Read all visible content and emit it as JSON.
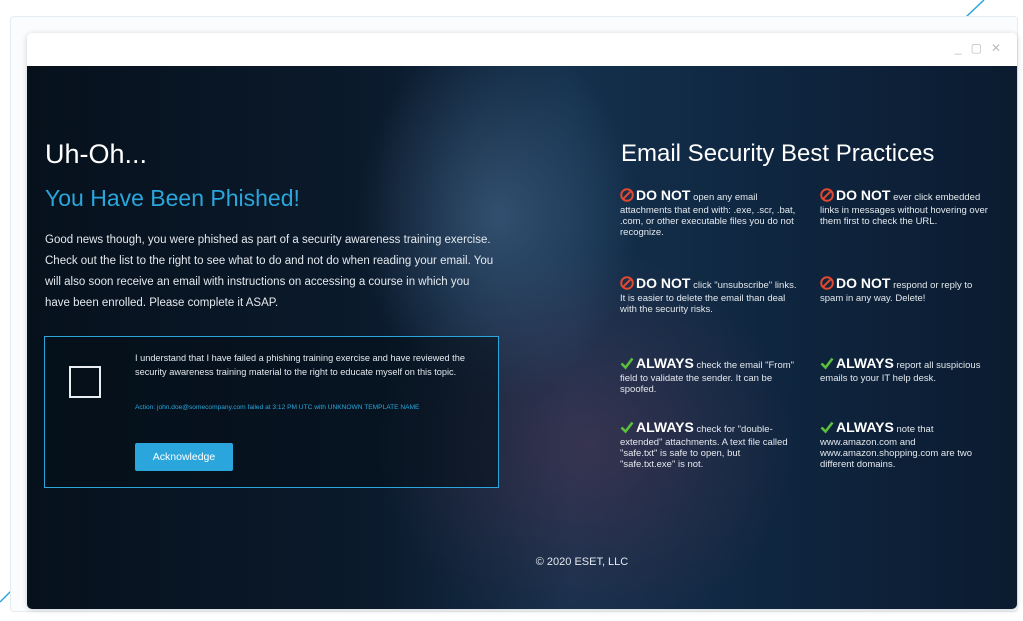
{
  "window": {
    "controls": {
      "minimize": "_",
      "maximize": "▢",
      "close": "✕"
    }
  },
  "left": {
    "heading": "Uh-Oh...",
    "subheading": "You Have Been Phished!",
    "intro": "Good news though, you were phished as part of a security awareness training exercise. Check out the list to the right to see what to do and not do when reading your email. You will also soon receive an email with instructions on accessing a course in which you have been enrolled. Please complete it ASAP."
  },
  "acknowledge": {
    "statement": "I understand that I have failed a phishing training exercise and have reviewed the security awareness training material to the right to educate myself on this topic.",
    "meta": "Action: john.doe@somecompany.com failed at 3:12 PM UTC with UNKNOWN TEMPLATE NAME",
    "button": "Acknowledge"
  },
  "best_practices": {
    "title": "Email Security Best Practices",
    "tips": [
      {
        "kind": "dont",
        "head": "DO NOT",
        "text": "open any email attachments that end with: .exe, .scr, .bat, .com, or other executable files you do not recognize."
      },
      {
        "kind": "dont",
        "head": "DO NOT",
        "text": "ever click embedded links in messages without hovering over them first to check the URL."
      },
      {
        "kind": "dont",
        "head": "DO NOT",
        "text": "click \"unsubscribe\" links. It is easier to delete the email than deal with the security risks."
      },
      {
        "kind": "dont",
        "head": "DO NOT",
        "text": "respond or reply to spam in any way. Delete!"
      },
      {
        "kind": "do",
        "head": "ALWAYS",
        "text": "check the email \"From\" field to validate the sender. It can be spoofed."
      },
      {
        "kind": "do",
        "head": "ALWAYS",
        "text": "report all suspicious emails to your IT help desk."
      },
      {
        "kind": "do",
        "head": "ALWAYS",
        "text": "check for \"double-extended\" attachments. A text file called \"safe.txt\" is safe to open, but \"safe.txt.exe\" is not."
      },
      {
        "kind": "do",
        "head": "ALWAYS",
        "text": "note that www.amazon.com and www.amazon.shopping.com are two different domains."
      }
    ]
  },
  "footer": "© 2020 ESET, LLC",
  "colors": {
    "accent": "#2aa6dc",
    "dont_icon": "#e0482f",
    "do_icon": "#5bbf3c"
  }
}
